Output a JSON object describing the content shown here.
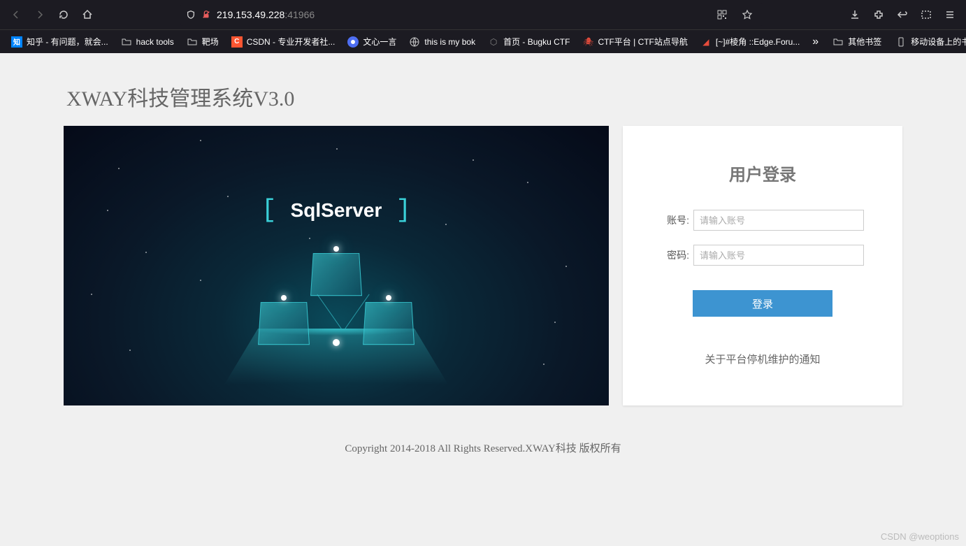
{
  "browser": {
    "url_main": "219.153.49.228",
    "url_port": ":41966",
    "bookmarks": [
      {
        "icon": "zhihu",
        "label": "知乎 - 有问题，就会..."
      },
      {
        "icon": "folder",
        "label": "hack tools"
      },
      {
        "icon": "folder",
        "label": "靶场"
      },
      {
        "icon": "csdn",
        "label": "CSDN - 专业开发者社..."
      },
      {
        "icon": "ernie",
        "label": "文心一言"
      },
      {
        "icon": "globe",
        "label": "this is my bok"
      },
      {
        "icon": "bugku",
        "label": "首页 - Bugku CTF"
      },
      {
        "icon": "ctf",
        "label": "CTF平台 | CTF站点导航"
      },
      {
        "icon": "edge",
        "label": "[~]#棱角 ::Edge.Foru..."
      }
    ],
    "other_bookmarks": "其他书签",
    "mobile_bookmarks": "移动设备上的书签"
  },
  "page": {
    "title": "XWAY科技管理系统V3.0",
    "hero_text": "SqlServer",
    "login": {
      "title": "用户登录",
      "account_label": "账号:",
      "account_placeholder": "请输入账号",
      "password_label": "密码:",
      "password_placeholder": "请输入账号",
      "button": "登录",
      "notice": "关于平台停机维护的通知"
    },
    "footer": "Copyright 2014-2018 All Rights Reserved.XWAY科技 版权所有"
  },
  "watermark": "CSDN @weoptions"
}
